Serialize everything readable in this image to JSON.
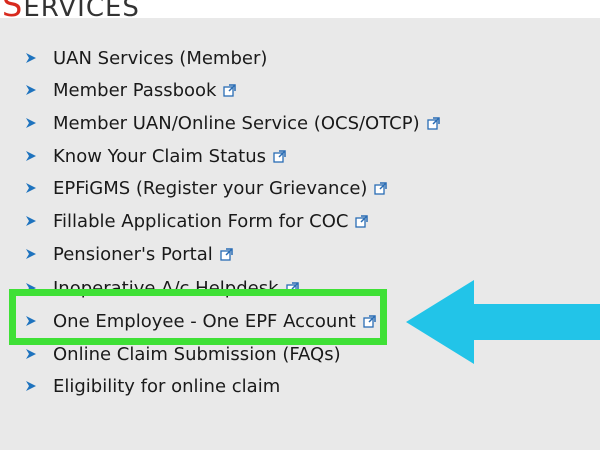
{
  "header": {
    "title_first": "S",
    "title_rest": "ERVICES"
  },
  "colors": {
    "panel_bg": "#e9e9e9",
    "bullet": "#1e73be",
    "ext_icon": "#2a6db5",
    "highlight_border": "#3fe036",
    "arrow": "#22c4e8",
    "title_first_letter": "#d82a1e"
  },
  "services": [
    {
      "label": "UAN Services (Member)",
      "external": false
    },
    {
      "label": "Member Passbook",
      "external": true
    },
    {
      "label": "Member UAN/Online Service (OCS/OTCP)",
      "external": true
    },
    {
      "label": "Know Your Claim Status",
      "external": true
    },
    {
      "label": "EPFiGMS (Register your Grievance)",
      "external": true
    },
    {
      "label": "Fillable Application Form for COC",
      "external": true
    },
    {
      "label": "Pensioner's Portal",
      "external": true
    },
    {
      "label": "Inoperative A/c Helpdesk",
      "external": true
    },
    {
      "label": "One Employee - One EPF Account",
      "external": true
    },
    {
      "label": "Online Claim Submission (FAQs)",
      "external": false
    },
    {
      "label": "Eligibility for online claim",
      "external": false
    }
  ],
  "icons": {
    "bullet": "arrow-bullet-icon",
    "external": "external-link-icon",
    "pointer": "pointer-arrow-icon"
  }
}
